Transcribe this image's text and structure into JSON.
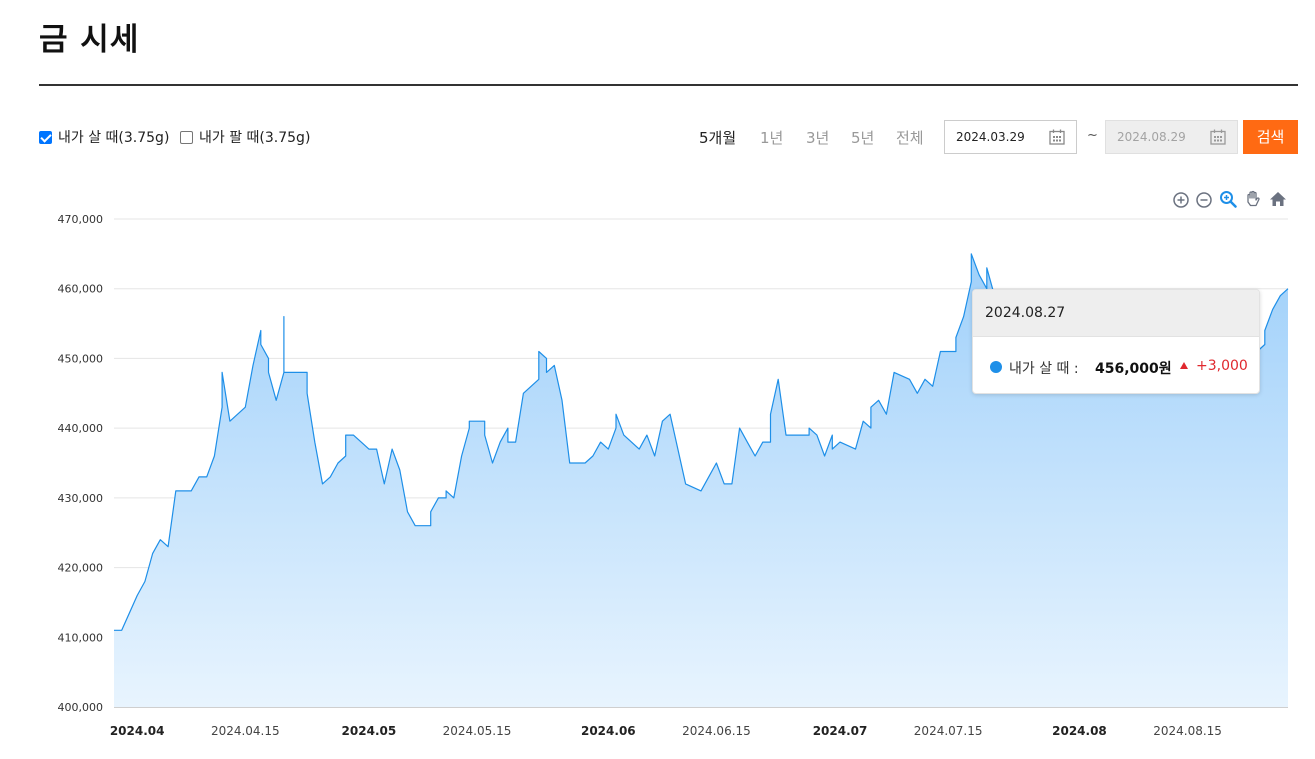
{
  "page": {
    "title": "금 시세"
  },
  "options": {
    "buy": {
      "label": "내가 살 때(3.75g)",
      "checked": true
    },
    "sell": {
      "label": "내가 팔 때(3.75g)",
      "checked": false
    }
  },
  "periods": [
    "5개월",
    "1년",
    "3년",
    "5년",
    "전체"
  ],
  "active_period": "5개월",
  "date_range": {
    "start": "2024.03.29",
    "separator": "~",
    "end": "2024.08.29"
  },
  "search_button": "검색",
  "toolbar_icons": [
    "zoom-in-icon",
    "zoom-out-icon",
    "magnify-icon",
    "pan-hand-icon",
    "home-icon"
  ],
  "colors": {
    "line": "#1e8fe8",
    "area_top": "#9fd0fa",
    "area_bottom": "#e8f4fe",
    "accent": "#ff6a13",
    "up": "#e0282e"
  },
  "tooltip": {
    "date": "2024.08.27",
    "label": "내가 살 때 :",
    "value": "456,000원",
    "change": "+3,000"
  },
  "chart_data": {
    "type": "area",
    "series": [
      {
        "name": "내가 살 때",
        "values": [
          [
            "2024-03-29",
            411000
          ],
          [
            "2024-03-30",
            411000
          ],
          [
            "2024-04-01",
            416000
          ],
          [
            "2024-04-02",
            418000
          ],
          [
            "2024-04-03",
            422000
          ],
          [
            "2024-04-04",
            424000
          ],
          [
            "2024-04-05",
            423000
          ],
          [
            "2024-04-06",
            431000
          ],
          [
            "2024-04-08",
            431000
          ],
          [
            "2024-04-09",
            433000
          ],
          [
            "2024-04-10",
            433000
          ],
          [
            "2024-04-11",
            436000
          ],
          [
            "2024-04-12",
            443000
          ],
          [
            "2024-04-12",
            448000
          ],
          [
            "2024-04-13",
            441000
          ],
          [
            "2024-04-15",
            443000
          ],
          [
            "2024-04-16",
            449000
          ],
          [
            "2024-04-17",
            454000
          ],
          [
            "2024-04-17",
            452000
          ],
          [
            "2024-04-18",
            450000
          ],
          [
            "2024-04-18",
            448000
          ],
          [
            "2024-04-19",
            444000
          ],
          [
            "2024-04-20",
            448000
          ],
          [
            "2024-04-20",
            456000
          ],
          [
            "2024-04-20",
            448000
          ],
          [
            "2024-04-22",
            448000
          ],
          [
            "2024-04-23",
            448000
          ],
          [
            "2024-04-23",
            445000
          ],
          [
            "2024-04-24",
            438000
          ],
          [
            "2024-04-25",
            432000
          ],
          [
            "2024-04-26",
            433000
          ],
          [
            "2024-04-27",
            435000
          ],
          [
            "2024-04-28",
            436000
          ],
          [
            "2024-04-28",
            439000
          ],
          [
            "2024-04-29",
            439000
          ],
          [
            "2024-04-30",
            438000
          ],
          [
            "2024-05-01",
            437000
          ],
          [
            "2024-05-02",
            437000
          ],
          [
            "2024-05-03",
            432000
          ],
          [
            "2024-05-04",
            437000
          ],
          [
            "2024-05-05",
            434000
          ],
          [
            "2024-05-06",
            428000
          ],
          [
            "2024-05-07",
            426000
          ],
          [
            "2024-05-08",
            426000
          ],
          [
            "2024-05-09",
            426000
          ],
          [
            "2024-05-09",
            428000
          ],
          [
            "2024-05-10",
            430000
          ],
          [
            "2024-05-11",
            430000
          ],
          [
            "2024-05-11",
            431000
          ],
          [
            "2024-05-12",
            430000
          ],
          [
            "2024-05-13",
            436000
          ],
          [
            "2024-05-14",
            440000
          ],
          [
            "2024-05-14",
            441000
          ],
          [
            "2024-05-15",
            441000
          ],
          [
            "2024-05-16",
            441000
          ],
          [
            "2024-05-16",
            439000
          ],
          [
            "2024-05-17",
            435000
          ],
          [
            "2024-05-18",
            438000
          ],
          [
            "2024-05-19",
            440000
          ],
          [
            "2024-05-19",
            438000
          ],
          [
            "2024-05-20",
            438000
          ],
          [
            "2024-05-21",
            445000
          ],
          [
            "2024-05-22",
            446000
          ],
          [
            "2024-05-23",
            447000
          ],
          [
            "2024-05-23",
            451000
          ],
          [
            "2024-05-24",
            450000
          ],
          [
            "2024-05-24",
            448000
          ],
          [
            "2024-05-25",
            449000
          ],
          [
            "2024-05-26",
            444000
          ],
          [
            "2024-05-27",
            435000
          ],
          [
            "2024-05-28",
            435000
          ],
          [
            "2024-05-29",
            435000
          ],
          [
            "2024-05-30",
            436000
          ],
          [
            "2024-05-31",
            438000
          ],
          [
            "2024-06-01",
            437000
          ],
          [
            "2024-06-02",
            440000
          ],
          [
            "2024-06-02",
            442000
          ],
          [
            "2024-06-03",
            439000
          ],
          [
            "2024-06-05",
            437000
          ],
          [
            "2024-06-06",
            439000
          ],
          [
            "2024-06-07",
            436000
          ],
          [
            "2024-06-08",
            441000
          ],
          [
            "2024-06-09",
            442000
          ],
          [
            "2024-06-11",
            432000
          ],
          [
            "2024-06-13",
            431000
          ],
          [
            "2024-06-14",
            433000
          ],
          [
            "2024-06-15",
            435000
          ],
          [
            "2024-06-16",
            432000
          ],
          [
            "2024-06-17",
            432000
          ],
          [
            "2024-06-18",
            440000
          ],
          [
            "2024-06-19",
            438000
          ],
          [
            "2024-06-20",
            436000
          ],
          [
            "2024-06-21",
            438000
          ],
          [
            "2024-06-22",
            438000
          ],
          [
            "2024-06-22",
            442000
          ],
          [
            "2024-06-23",
            447000
          ],
          [
            "2024-06-24",
            439000
          ],
          [
            "2024-06-25",
            439000
          ],
          [
            "2024-06-26",
            439000
          ],
          [
            "2024-06-27",
            439000
          ],
          [
            "2024-06-27",
            440000
          ],
          [
            "2024-06-28",
            439000
          ],
          [
            "2024-06-29",
            436000
          ],
          [
            "2024-06-30",
            439000
          ],
          [
            "2024-06-30",
            437000
          ],
          [
            "2024-07-01",
            438000
          ],
          [
            "2024-07-03",
            437000
          ],
          [
            "2024-07-04",
            441000
          ],
          [
            "2024-07-05",
            440000
          ],
          [
            "2024-07-05",
            443000
          ],
          [
            "2024-07-06",
            444000
          ],
          [
            "2024-07-07",
            442000
          ],
          [
            "2024-07-08",
            448000
          ],
          [
            "2024-07-10",
            447000
          ],
          [
            "2024-07-11",
            445000
          ],
          [
            "2024-07-12",
            447000
          ],
          [
            "2024-07-13",
            446000
          ],
          [
            "2024-07-14",
            451000
          ],
          [
            "2024-07-15",
            451000
          ],
          [
            "2024-07-16",
            451000
          ],
          [
            "2024-07-16",
            453000
          ],
          [
            "2024-07-17",
            456000
          ],
          [
            "2024-07-18",
            461000
          ],
          [
            "2024-07-18",
            465000
          ],
          [
            "2024-07-19",
            462000
          ],
          [
            "2024-07-20",
            460000
          ],
          [
            "2024-07-20",
            463000
          ],
          [
            "2024-07-21",
            459000
          ],
          [
            "2024-08-23",
            452000
          ],
          [
            "2024-08-24",
            451000
          ],
          [
            "2024-08-25",
            452000
          ],
          [
            "2024-08-25",
            454000
          ],
          [
            "2024-08-26",
            457000
          ],
          [
            "2024-08-27",
            459000
          ],
          [
            "2024-08-28",
            460000
          ]
        ]
      }
    ],
    "xlim": [
      "2024-03-29",
      "2024-08-28"
    ],
    "ylim": [
      400000,
      470000
    ],
    "yticks": [
      "400,000",
      "410,000",
      "420,000",
      "430,000",
      "440,000",
      "450,000",
      "460,000",
      "470,000"
    ],
    "xticks": [
      {
        "label": "2024.04",
        "date": "2024-04-01",
        "bold": true
      },
      {
        "label": "2024.04.15",
        "date": "2024-04-15",
        "bold": false
      },
      {
        "label": "2024.05",
        "date": "2024-05-01",
        "bold": true
      },
      {
        "label": "2024.05.15",
        "date": "2024-05-15",
        "bold": false
      },
      {
        "label": "2024.06",
        "date": "2024-06-01",
        "bold": true
      },
      {
        "label": "2024.06.15",
        "date": "2024-06-15",
        "bold": false
      },
      {
        "label": "2024.07",
        "date": "2024-07-01",
        "bold": true
      },
      {
        "label": "2024.07.15",
        "date": "2024-07-15",
        "bold": false
      },
      {
        "label": "2024.08",
        "date": "2024-08-01",
        "bold": true
      },
      {
        "label": "2024.08.15",
        "date": "2024-08-15",
        "bold": false
      }
    ],
    "grid": true
  }
}
